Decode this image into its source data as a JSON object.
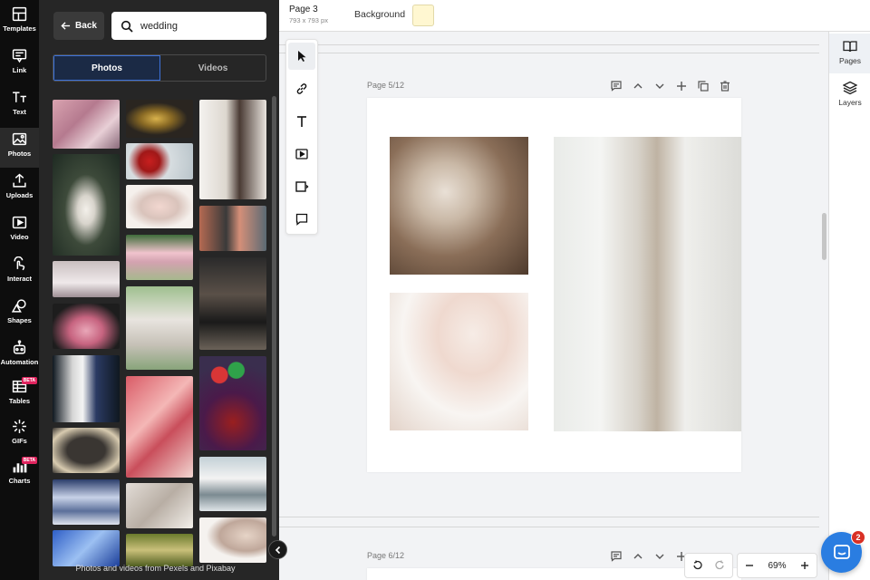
{
  "rail": {
    "items": [
      {
        "label": "Templates",
        "icon": "templates-icon"
      },
      {
        "label": "Link",
        "icon": "link-icon"
      },
      {
        "label": "Text",
        "icon": "text-icon"
      },
      {
        "label": "Photos",
        "icon": "photos-icon",
        "active": true
      },
      {
        "label": "Uploads",
        "icon": "uploads-icon"
      },
      {
        "label": "Video",
        "icon": "video-icon"
      },
      {
        "label": "Interact",
        "icon": "interact-icon"
      },
      {
        "label": "Shapes",
        "icon": "shapes-icon"
      },
      {
        "label": "Automation",
        "icon": "automation-icon"
      },
      {
        "label": "Tables",
        "icon": "tables-icon",
        "badge": "BETA"
      },
      {
        "label": "GIFs",
        "icon": "gifs-icon"
      },
      {
        "label": "Charts",
        "icon": "charts-icon",
        "badge": "BETA"
      }
    ]
  },
  "panel": {
    "back_label": "Back",
    "search": {
      "value": "wedding",
      "placeholder": "Search"
    },
    "tabs": [
      {
        "label": "Photos",
        "active": true
      },
      {
        "label": "Videos"
      }
    ],
    "credit": "Photos and videos from Pexels and Pixabay"
  },
  "topbar": {
    "page_title": "Page 3",
    "page_size": "793 x 793 px",
    "background_label": "Background",
    "background_color": "#fff7d1"
  },
  "canvas": {
    "pages": [
      {
        "label": "Page 5/12"
      },
      {
        "label": "Page 6/12"
      }
    ]
  },
  "right_sidebar": {
    "items": [
      {
        "label": "Pages",
        "active": true
      },
      {
        "label": "Layers"
      }
    ]
  },
  "zoom": {
    "value": "69%"
  },
  "chat": {
    "badge": "2"
  },
  "colors": {
    "accent": "#3d72d9",
    "chat": "#2a7de1",
    "badge": "#e0245e"
  }
}
